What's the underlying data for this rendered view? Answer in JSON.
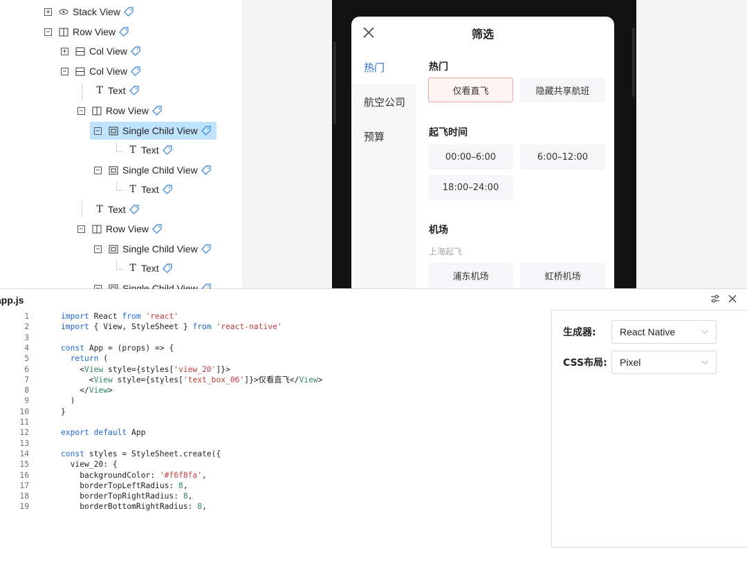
{
  "tree": {
    "rows": [
      {
        "label": "Stack View",
        "toggle": "+",
        "icon": "eye-icon"
      },
      {
        "label": "Row View",
        "toggle": "−",
        "icon": "row-view-icon"
      },
      {
        "label": "Col View",
        "toggle": "+",
        "icon": "col-view-icon"
      },
      {
        "label": "Col View",
        "toggle": "−",
        "icon": "col-view-icon"
      },
      {
        "label": "Text",
        "toggle": "",
        "icon": "text-icon"
      },
      {
        "label": "Row View",
        "toggle": "−",
        "icon": "row-view-icon"
      },
      {
        "label": "Single Child View",
        "toggle": "−",
        "icon": "single-child-view-icon",
        "selected": true
      },
      {
        "label": "Text",
        "toggle": "",
        "icon": "text-icon"
      },
      {
        "label": "Single Child View",
        "toggle": "−",
        "icon": "single-child-view-icon"
      },
      {
        "label": "Text",
        "toggle": "",
        "icon": "text-icon"
      },
      {
        "label": "Text",
        "toggle": "",
        "icon": "text-icon"
      },
      {
        "label": "Row View",
        "toggle": "−",
        "icon": "row-view-icon"
      },
      {
        "label": "Single Child View",
        "toggle": "−",
        "icon": "single-child-view-icon"
      },
      {
        "label": "Text",
        "toggle": "",
        "icon": "text-icon"
      },
      {
        "label": "Single Child View",
        "toggle": "−",
        "icon": "single-child-view-icon"
      }
    ],
    "tag_color": "#4a90e2"
  },
  "phone": {
    "title": "筛选",
    "close_icon": "close-icon",
    "nav": [
      "热门",
      "航空公司",
      "预算"
    ],
    "active_color": "#2f6fd6",
    "sections": {
      "hot": {
        "title": "热门",
        "chips": [
          "仅看直飞",
          "隐藏共享航班"
        ]
      },
      "time": {
        "title": "起飞时间",
        "chips": [
          "00:00–6:00",
          "6:00–12:00",
          "18:00–24:00"
        ]
      },
      "airport": {
        "title": "机场",
        "sub": "上海起飞",
        "chips": [
          "浦东机场",
          "虹桥机场"
        ]
      }
    }
  },
  "code_panel": {
    "filename": "app.js",
    "icons": [
      "settings-sliders-icon",
      "close-icon"
    ],
    "lines": [
      "import React from 'react'",
      "import { View, StyleSheet } from 'react-native'",
      "",
      "const App = (props) => {",
      "  return (",
      "    <View style={styles['view_20']}>",
      "      <View style={styles['text_box_06']}>仅看直飞</View>",
      "    </View>",
      "  )",
      "}",
      "",
      "export default App",
      "",
      "const styles = StyleSheet.create({",
      "  view_20: {",
      "    backgroundColor: '#f6f8fa',",
      "    borderTopLeftRadius: 8,",
      "    borderTopRightRadius: 8,",
      "    borderBottomRightRadius: 8,"
    ]
  },
  "settings": {
    "generator_label": "生成器:",
    "generator_value": "React Native",
    "layout_label": "CSS布局:",
    "layout_value": "Pixel"
  }
}
